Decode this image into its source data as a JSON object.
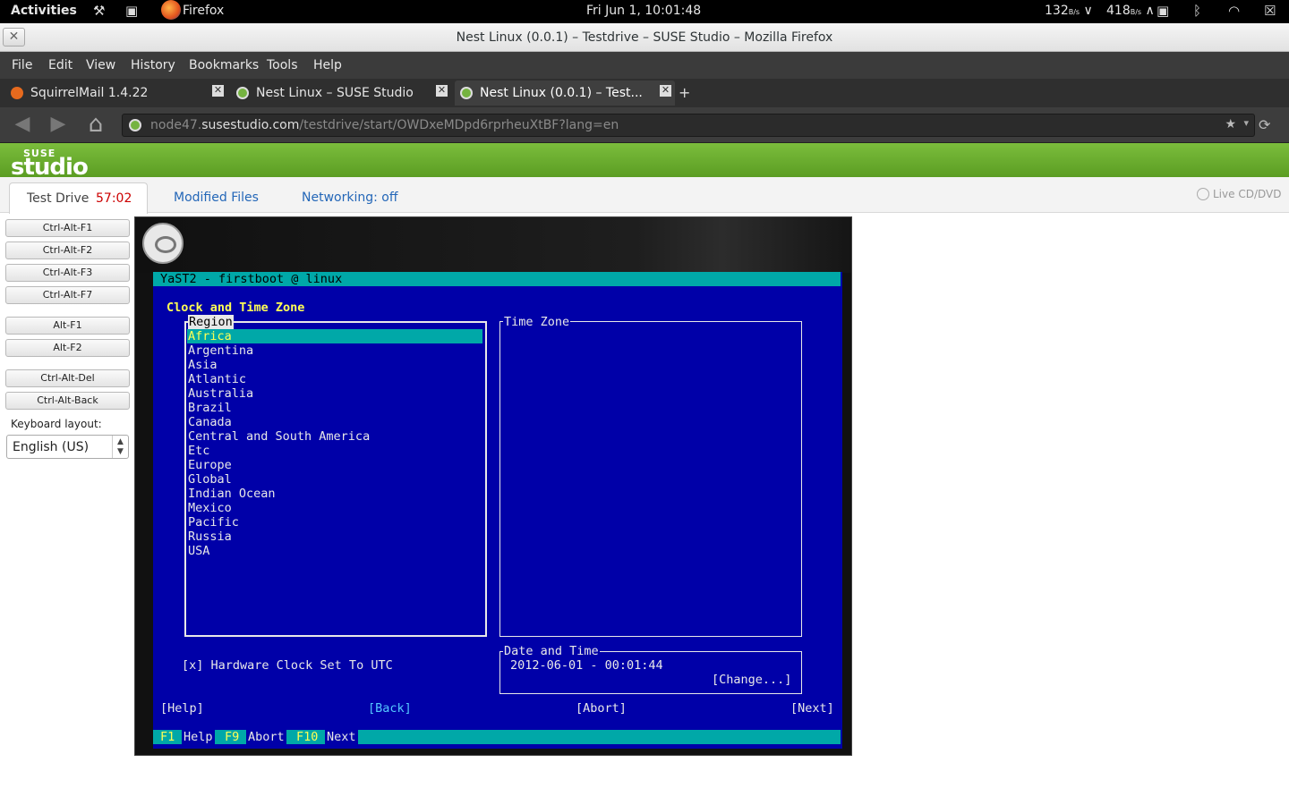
{
  "topbar": {
    "activities": "Activities",
    "app_name": "Firefox",
    "clock": "Fri Jun  1, 10:01:48",
    "net_down": "132",
    "net_down_unit": "B/s",
    "net_up": "418",
    "net_up_unit": "B/s"
  },
  "window": {
    "title": "Nest Linux (0.0.1) – Testdrive – SUSE Studio – Mozilla Firefox",
    "close_glyph": "✕"
  },
  "menu": [
    "File",
    "Edit",
    "View",
    "History",
    "Bookmarks",
    "Tools",
    "Help"
  ],
  "tabs": [
    {
      "label": "SquirrelMail 1.4.22",
      "icon_color": "#e66a1e"
    },
    {
      "label": "Nest Linux – SUSE Studio",
      "icon_color": "#75b340"
    },
    {
      "label": "Nest Linux (0.0.1) – Test...",
      "icon_color": "#75b340"
    }
  ],
  "tab_close_glyph": "✕",
  "new_tab_glyph": "+",
  "nav": {
    "back_glyph": "◀",
    "forward_glyph": "▶",
    "home_glyph": "⌂",
    "url_prefix": "node47.",
    "url_domain": "susestudio.com",
    "url_path": "/testdrive/start/OWDxeMDpd6rprheuXtBF?lang=en",
    "star_glyph": "★",
    "dropdown_glyph": "▾",
    "reload_glyph": "⟳"
  },
  "suse": {
    "logo_top": "SUSE",
    "logo_bottom": "studio"
  },
  "pagetabs": {
    "test_drive": "Test Drive",
    "timer": "57:02",
    "modified_files": "Modified Files",
    "networking": "Networking: off",
    "live_cd": "Live CD/DVD"
  },
  "sidebar": {
    "buttons": [
      "Ctrl-Alt-F1",
      "Ctrl-Alt-F2",
      "Ctrl-Alt-F3",
      "Ctrl-Alt-F7",
      "Alt-F1",
      "Alt-F2",
      "Ctrl-Alt-Del",
      "Ctrl-Alt-Back"
    ],
    "keyboard_label": "Keyboard layout:",
    "keyboard_value": "English (US)"
  },
  "term": {
    "title": "YaST2 - firstboot @ linux",
    "heading": "Clock and Time Zone",
    "region_label": "Region",
    "timezone_label": "Time Zone",
    "regions": [
      "Africa",
      "Argentina",
      "Asia",
      "Atlantic",
      "Australia",
      "Brazil",
      "Canada",
      "Central and South America",
      "Etc",
      "Europe",
      "Global",
      "Indian Ocean",
      "Mexico",
      "Pacific",
      "Russia",
      "USA"
    ],
    "selected_region": "Africa",
    "hw_clock": "[x] Hardware Clock Set To UTC",
    "date_time_label": "Date and Time",
    "date_time_value": "2012-06-01 - 00:01:44",
    "change_button": "[Change...]",
    "help_button": "[Help]",
    "back_button": "[Back]",
    "abort_button": "[Abort]",
    "next_button": "[Next]",
    "footer": [
      {
        "key": "F1",
        "label": "Help"
      },
      {
        "key": "F9",
        "label": "Abort"
      },
      {
        "key": "F10",
        "label": "Next"
      }
    ]
  }
}
